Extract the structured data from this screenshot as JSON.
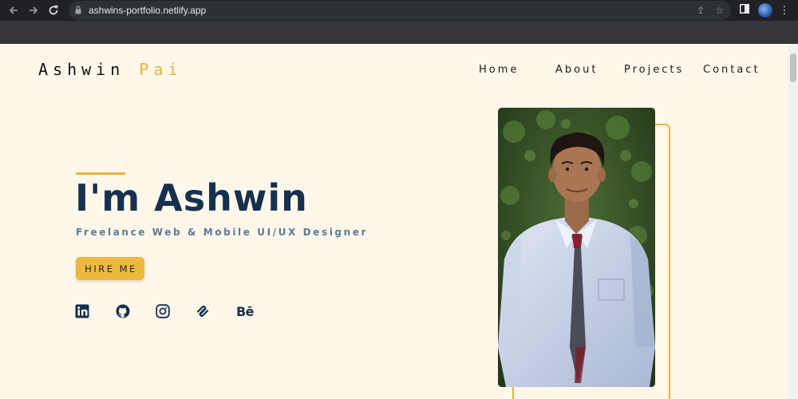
{
  "browser": {
    "url": "ashwins-portfolio.netlify.app",
    "back_icon": "arrow-left-icon",
    "forward_icon": "arrow-right-icon",
    "reload_icon": "reload-icon"
  },
  "site": {
    "logo_first": "Ashwin",
    "logo_last": "Pai",
    "accent_color": "#e9b23f",
    "navy_color": "#16304f",
    "background_color": "#fff8ea"
  },
  "nav": {
    "items": [
      {
        "label": "Home"
      },
      {
        "label": "About"
      },
      {
        "label": "Projects"
      },
      {
        "label": "Contact"
      }
    ]
  },
  "hero": {
    "title": "I'm Ashwin",
    "subtitle": "Freelance Web & Mobile UI/UX Designer",
    "cta_label": "HIRE ME"
  },
  "social": {
    "icons": [
      "linkedin-icon",
      "github-icon",
      "instagram-icon",
      "squarespace-icon",
      "behance-icon"
    ],
    "behance_text": "Bē"
  }
}
